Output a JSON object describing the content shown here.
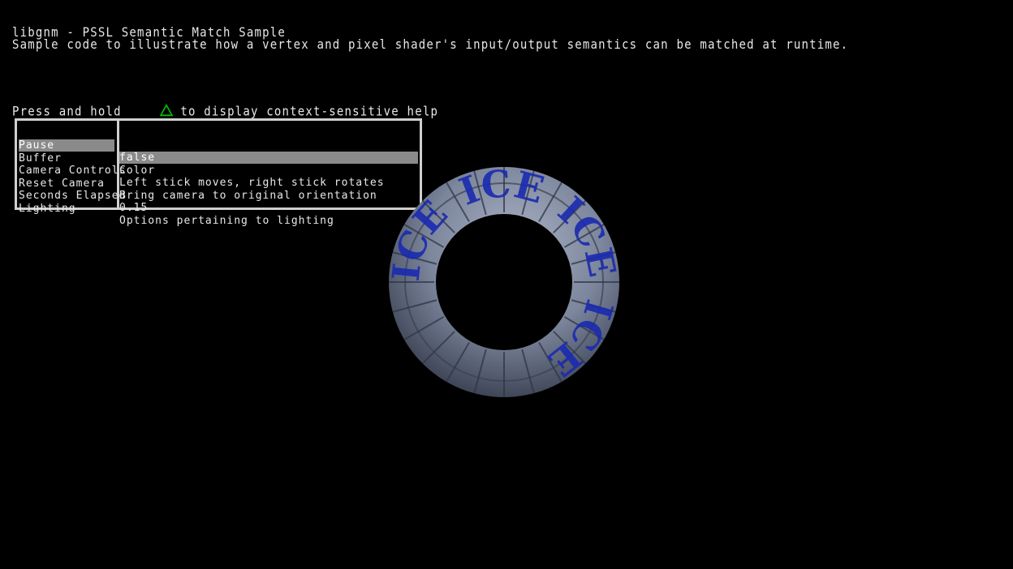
{
  "header": {
    "title": "libgnm - PSSL Semantic Match Sample",
    "subtitle": "Sample code to illustrate how a vertex and pixel shader's input/output semantics can be matched at runtime.",
    "help_prefix": "Press and hold",
    "help_suffix": "to display context-sensitive help",
    "help_icon": "triangle-button-icon",
    "help_icon_color": "#00c000"
  },
  "menu": {
    "items": [
      {
        "label": "Pause",
        "value": "false",
        "selected": true
      },
      {
        "label": "Buffer",
        "value": "Color"
      },
      {
        "label": "Camera Controls",
        "value": "Left stick moves, right stick rotates"
      },
      {
        "label": "Reset Camera",
        "value": "Bring camera to original orientation"
      },
      {
        "label": "Seconds Elapsed",
        "value": "0.15"
      },
      {
        "label": "Lighting",
        "value": "Options pertaining to lighting"
      }
    ]
  },
  "scene": {
    "object": "rotating-ring",
    "ring_text": "ICE",
    "ring_text_color": "#1a2ab0",
    "ring_color": "#7c869c"
  }
}
